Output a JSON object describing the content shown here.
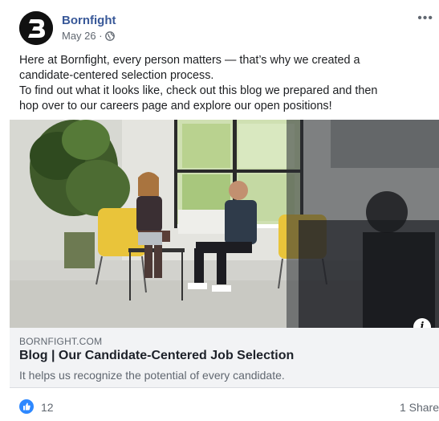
{
  "post": {
    "page_name": "Bornfight",
    "date": "May 26 ·",
    "globe_icon": "globe-icon",
    "more_icon": "more-options-icon",
    "text_lines": [
      "Here at Bornfight, every person matters — that’s why we created a",
      "candidate-centered selection process.",
      "To find out what it looks like, check out this blog we prepared and then",
      "hop over to our careers page and explore our open positions!"
    ]
  },
  "link_preview": {
    "domain": "BORNFIGHT.COM",
    "title": "Blog | Our Candidate-Centered Job Selection",
    "description": "It helps us recognize the potential of every candidate.",
    "info_label": "i"
  },
  "footer": {
    "likes_count": "12",
    "shares": "1 Share"
  },
  "colors": {
    "page_name": "#385898",
    "like_blue": "#2d88ff",
    "link_bg": "#f2f3f5",
    "secondary_text": "#606770"
  }
}
